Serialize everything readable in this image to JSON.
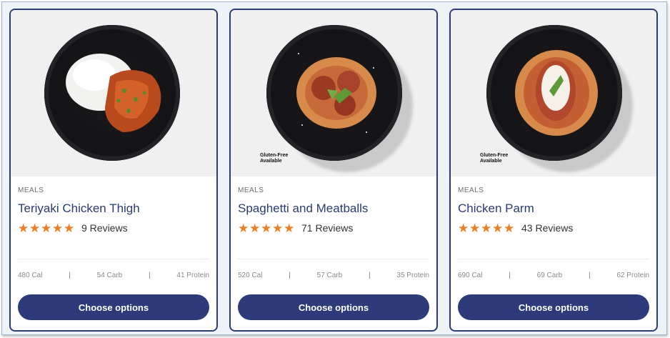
{
  "cards": [
    {
      "category": "MEALS",
      "title": "Teriyaki Chicken Thigh",
      "reviews": "9 Reviews",
      "rating": 5,
      "badge": "",
      "macros": {
        "cal": "480 Cal",
        "carb": "54 Carb",
        "protein": "41 Protein",
        "sep": "|"
      },
      "cta": "Choose options"
    },
    {
      "category": "MEALS",
      "title": "Spaghetti and Meatballs",
      "reviews": "71 Reviews",
      "rating": 5,
      "badge": "Gluten-Free Available",
      "macros": {
        "cal": "520 Cal",
        "carb": "57 Carb",
        "protein": "35 Protein",
        "sep": "|"
      },
      "cta": "Choose options"
    },
    {
      "category": "MEALS",
      "title": "Chicken Parm",
      "reviews": "43 Reviews",
      "rating": 5,
      "badge": "Gluten-Free Available",
      "macros": {
        "cal": "690 Cal",
        "carb": "69 Carb",
        "protein": "62 Protein",
        "sep": "|"
      },
      "cta": "Choose options"
    }
  ],
  "colors": {
    "accent": "#2d3b7a",
    "star": "#f47a20",
    "border": "#2b3a78"
  }
}
